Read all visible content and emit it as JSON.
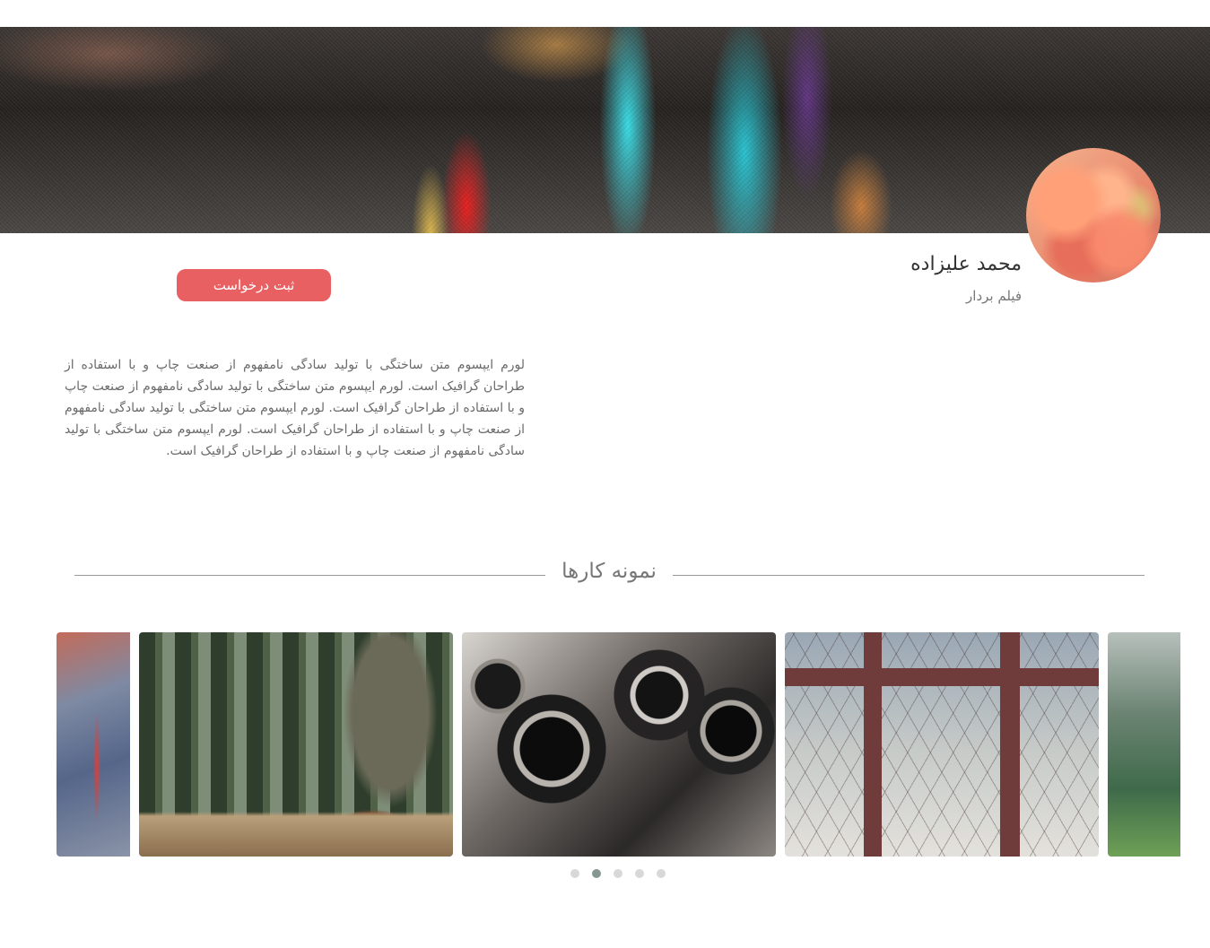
{
  "profile": {
    "name": "محمد علیزاده",
    "role": "فیلم بردار",
    "request_button_label": "ثبت درخواست",
    "bio": "لورم ایپسوم متن ساختگی با تولید سادگی نامفهوم از صنعت چاپ و با استفاده از طراحان گرافیک است. لورم ایپسوم متن ساختگی با تولید سادگی نامفهوم از صنعت چاپ و با استفاده از طراحان گرافیک است. لورم ایپسوم متن ساختگی با تولید سادگی نامفهوم از صنعت چاپ و با استفاده از طراحان گرافیک است. لورم ایپسوم متن ساختگی با تولید سادگی نامفهوم از صنعت چاپ و با استفاده از طراحان گرافیک است."
  },
  "portfolio": {
    "title": "نمونه کارها",
    "slides": [
      "light-trails-photo",
      "walking-in-forest-photo",
      "vintage-camera-photo",
      "bridge-photo",
      "foggy-hills-photo"
    ],
    "dots_count": 5,
    "active_dot": 2
  },
  "colors": {
    "accent_button": "#e96062",
    "active_dot": "#869791",
    "inactive_dot": "#d8d8d8"
  }
}
